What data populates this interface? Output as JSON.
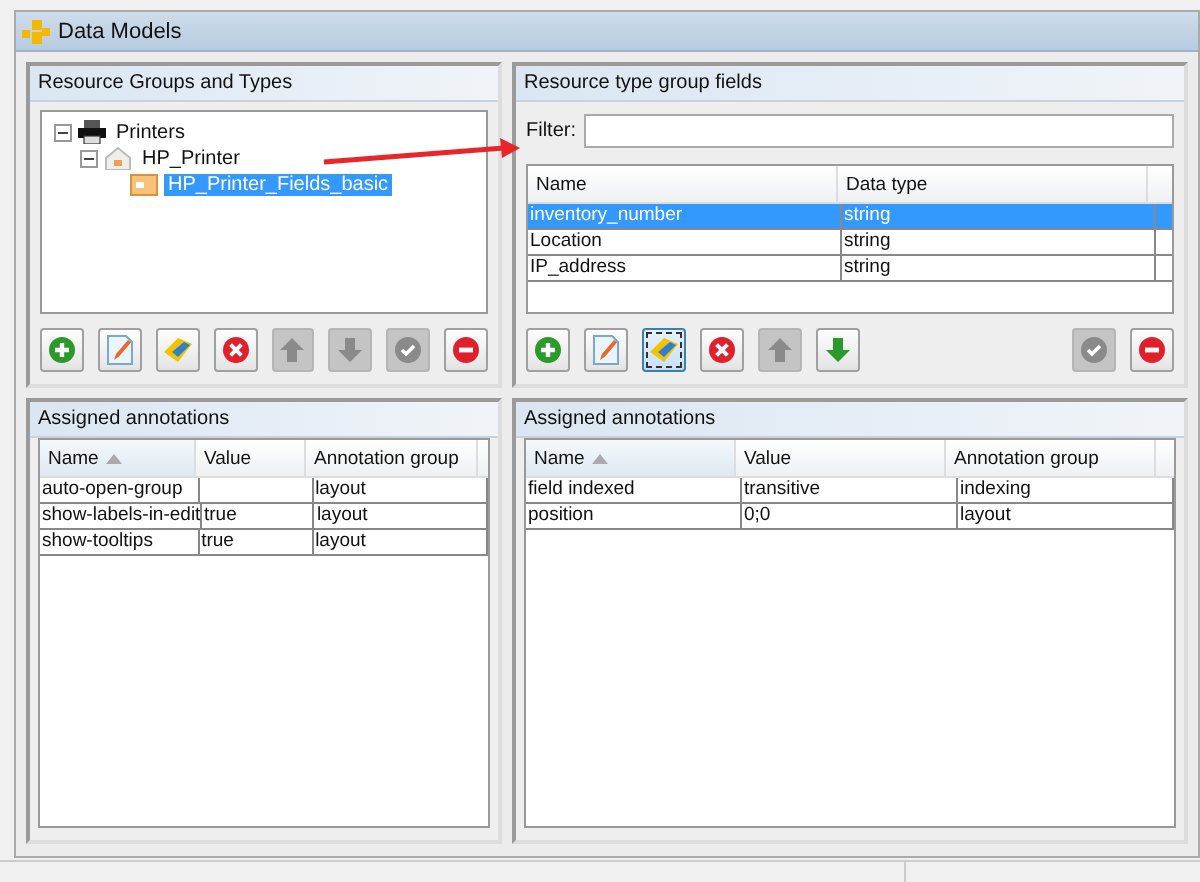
{
  "window": {
    "title": "Data Models"
  },
  "left": {
    "title": "Resource Groups and Types",
    "tree": [
      {
        "label": "Printers",
        "kind": "printer",
        "expanded": true,
        "selected": false,
        "children": [
          {
            "label": "HP_Printer",
            "kind": "group",
            "expanded": true,
            "selected": false,
            "children": [
              {
                "label": "HP_Printer_Fields_basic",
                "kind": "type",
                "selected": true
              }
            ]
          }
        ]
      }
    ],
    "toolbar": [
      {
        "kind": "add",
        "disabled": false,
        "focused": false
      },
      {
        "kind": "edit",
        "disabled": false,
        "focused": false
      },
      {
        "kind": "tag",
        "disabled": false,
        "focused": false
      },
      {
        "kind": "delete",
        "disabled": false,
        "focused": false
      },
      {
        "kind": "up",
        "disabled": true,
        "focused": false
      },
      {
        "kind": "down",
        "disabled": true,
        "focused": false
      },
      {
        "kind": "check",
        "disabled": true,
        "focused": false
      },
      {
        "kind": "remove",
        "disabled": false,
        "focused": false
      }
    ],
    "annotations": {
      "title": "Assigned annotations",
      "columns": [
        {
          "label": "Name",
          "sorted": true
        },
        {
          "label": "Value",
          "sorted": false
        },
        {
          "label": "Annotation group",
          "sorted": false
        }
      ],
      "rows": [
        [
          "auto-open-group",
          "",
          "layout"
        ],
        [
          "show-labels-in-edit",
          "true",
          "layout"
        ],
        [
          "show-tooltips",
          "true",
          "layout"
        ]
      ]
    }
  },
  "right": {
    "title": "Resource type group fields",
    "filter": {
      "label": "Filter:"
    },
    "fields": {
      "columns": [
        "Name",
        "Data type"
      ],
      "rows": [
        {
          "cells": [
            "inventory_number",
            "string"
          ],
          "selected": true
        },
        {
          "cells": [
            "Location",
            "string"
          ],
          "selected": false
        },
        {
          "cells": [
            "IP_address",
            "string"
          ],
          "selected": false
        }
      ]
    },
    "toolbar": [
      {
        "kind": "add",
        "disabled": false,
        "focused": false
      },
      {
        "kind": "edit",
        "disabled": false,
        "focused": false
      },
      {
        "kind": "tag",
        "disabled": false,
        "focused": true
      },
      {
        "kind": "delete",
        "disabled": false,
        "focused": false
      },
      {
        "kind": "up",
        "disabled": true,
        "focused": false
      },
      {
        "kind": "down",
        "disabled": false,
        "focused": false
      },
      {
        "kind": "check",
        "disabled": true,
        "focused": false
      },
      {
        "kind": "remove",
        "disabled": false,
        "focused": false
      }
    ],
    "annotations": {
      "title": "Assigned annotations",
      "columns": [
        {
          "label": "Name",
          "sorted": true
        },
        {
          "label": "Value",
          "sorted": false
        },
        {
          "label": "Annotation group",
          "sorted": false
        }
      ],
      "rows": [
        [
          "field indexed",
          "transitive",
          "indexing"
        ],
        [
          "position",
          "0;0",
          "layout"
        ]
      ]
    }
  }
}
